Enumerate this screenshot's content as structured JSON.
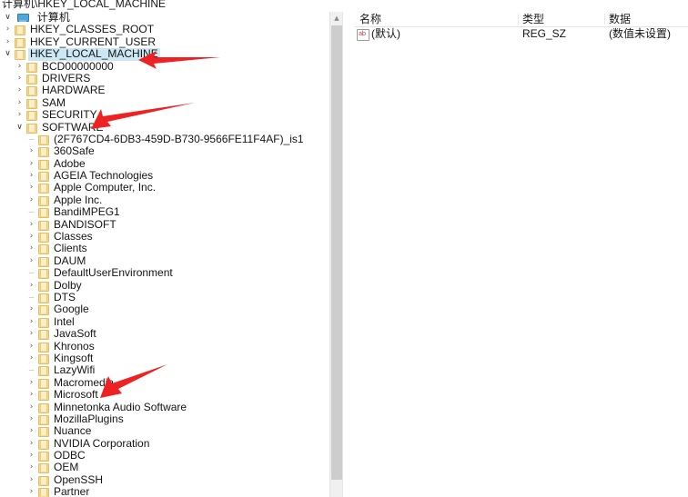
{
  "window": {
    "address_path": "计算机\\HKEY_LOCAL_MACHINE"
  },
  "tree": {
    "root": {
      "label": "计算机",
      "icon": "computer-icon",
      "twisty": "open"
    },
    "items": [
      {
        "label": "HKEY_CLASSES_ROOT",
        "indent": 1,
        "twisty": "closed",
        "selected": false
      },
      {
        "label": "HKEY_CURRENT_USER",
        "indent": 1,
        "twisty": "closed",
        "selected": false
      },
      {
        "label": "HKEY_LOCAL_MACHINE",
        "indent": 1,
        "twisty": "open",
        "selected": true
      },
      {
        "label": "BCD00000000",
        "indent": 2,
        "twisty": "closed",
        "selected": false
      },
      {
        "label": "DRIVERS",
        "indent": 2,
        "twisty": "closed",
        "selected": false
      },
      {
        "label": "HARDWARE",
        "indent": 2,
        "twisty": "closed",
        "selected": false
      },
      {
        "label": "SAM",
        "indent": 2,
        "twisty": "closed",
        "selected": false
      },
      {
        "label": "SECURITY",
        "indent": 2,
        "twisty": "closed",
        "selected": false
      },
      {
        "label": "SOFTWARE",
        "indent": 2,
        "twisty": "open",
        "selected": false
      },
      {
        "label": "(2F767CD4-6DB3-459D-B730-9566FE11F4AF)_is1",
        "indent": 3,
        "twisty": "none",
        "selected": false
      },
      {
        "label": "360Safe",
        "indent": 3,
        "twisty": "closed",
        "selected": false
      },
      {
        "label": "Adobe",
        "indent": 3,
        "twisty": "closed",
        "selected": false
      },
      {
        "label": "AGEIA Technologies",
        "indent": 3,
        "twisty": "closed",
        "selected": false
      },
      {
        "label": "Apple Computer, Inc.",
        "indent": 3,
        "twisty": "closed",
        "selected": false
      },
      {
        "label": "Apple Inc.",
        "indent": 3,
        "twisty": "closed",
        "selected": false
      },
      {
        "label": "BandiMPEG1",
        "indent": 3,
        "twisty": "none",
        "selected": false
      },
      {
        "label": "BANDISOFT",
        "indent": 3,
        "twisty": "closed",
        "selected": false
      },
      {
        "label": "Classes",
        "indent": 3,
        "twisty": "closed",
        "selected": false
      },
      {
        "label": "Clients",
        "indent": 3,
        "twisty": "closed",
        "selected": false
      },
      {
        "label": "DAUM",
        "indent": 3,
        "twisty": "closed",
        "selected": false
      },
      {
        "label": "DefaultUserEnvironment",
        "indent": 3,
        "twisty": "none",
        "selected": false
      },
      {
        "label": "Dolby",
        "indent": 3,
        "twisty": "closed",
        "selected": false
      },
      {
        "label": "DTS",
        "indent": 3,
        "twisty": "none",
        "selected": false
      },
      {
        "label": "Google",
        "indent": 3,
        "twisty": "closed",
        "selected": false
      },
      {
        "label": "Intel",
        "indent": 3,
        "twisty": "closed",
        "selected": false
      },
      {
        "label": "JavaSoft",
        "indent": 3,
        "twisty": "closed",
        "selected": false
      },
      {
        "label": "Khronos",
        "indent": 3,
        "twisty": "closed",
        "selected": false
      },
      {
        "label": "Kingsoft",
        "indent": 3,
        "twisty": "closed",
        "selected": false
      },
      {
        "label": "LazyWifi",
        "indent": 3,
        "twisty": "none",
        "selected": false
      },
      {
        "label": "Macromedia",
        "indent": 3,
        "twisty": "closed",
        "selected": false
      },
      {
        "label": "Microsoft",
        "indent": 3,
        "twisty": "closed",
        "selected": false
      },
      {
        "label": "Minnetonka Audio Software",
        "indent": 3,
        "twisty": "closed",
        "selected": false
      },
      {
        "label": "MozillaPlugins",
        "indent": 3,
        "twisty": "closed",
        "selected": false
      },
      {
        "label": "Nuance",
        "indent": 3,
        "twisty": "closed",
        "selected": false
      },
      {
        "label": "NVIDIA Corporation",
        "indent": 3,
        "twisty": "closed",
        "selected": false
      },
      {
        "label": "ODBC",
        "indent": 3,
        "twisty": "closed",
        "selected": false
      },
      {
        "label": "OEM",
        "indent": 3,
        "twisty": "closed",
        "selected": false
      },
      {
        "label": "OpenSSH",
        "indent": 3,
        "twisty": "closed",
        "selected": false
      },
      {
        "label": "Partner",
        "indent": 3,
        "twisty": "closed",
        "selected": false
      }
    ]
  },
  "values": {
    "columns": [
      {
        "key": "name",
        "label": "名称"
      },
      {
        "key": "type",
        "label": "类型"
      },
      {
        "key": "data",
        "label": "数据"
      }
    ],
    "rows": [
      {
        "icon": "string-value-icon",
        "name": "(默认)",
        "type": "REG_SZ",
        "data": "(数值未设置)"
      }
    ]
  },
  "annotations": {
    "arrows": [
      {
        "name": "arrow-hkey-local-machine",
        "color": "#ee2222"
      },
      {
        "name": "arrow-software",
        "color": "#ee2222"
      },
      {
        "name": "arrow-microsoft",
        "color": "#ee2222"
      }
    ]
  },
  "colors": {
    "selection": "#cce8f4",
    "folder": "#f5d98e",
    "arrow_red": "#ee2222",
    "scrollbar_thumb": "#cdcdcd"
  }
}
